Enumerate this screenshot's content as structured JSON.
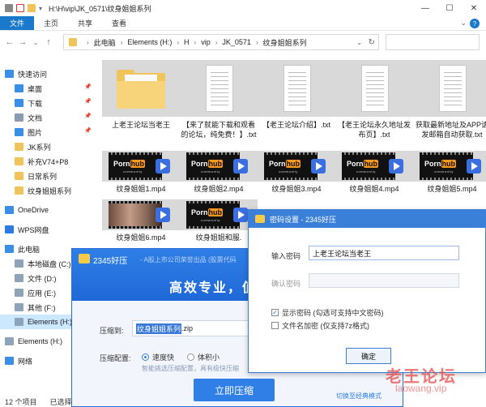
{
  "window": {
    "title": "H:\\H\\vip\\JK_0571\\纹身姐姐系列"
  },
  "ribbon": {
    "tabs": [
      "文件",
      "主页",
      "共享",
      "查看"
    ]
  },
  "address": {
    "crumbs": [
      "此电脑",
      "Elements (H:)",
      "H",
      "vip",
      "JK_0571",
      "纹身姐姐系列"
    ]
  },
  "sidebar": {
    "items": [
      {
        "label": "快速访问",
        "icon": "star-icon",
        "color": "#3a8ee6"
      },
      {
        "label": "桌面",
        "icon": "desktop-icon",
        "color": "#3a8ee6",
        "pinned": true
      },
      {
        "label": "下载",
        "icon": "download-icon",
        "color": "#3a8ee6",
        "pinned": true
      },
      {
        "label": "文档",
        "icon": "documents-icon",
        "color": "#8a9bb0",
        "pinned": true
      },
      {
        "label": "图片",
        "icon": "pictures-icon",
        "color": "#3a8ee6",
        "pinned": true
      },
      {
        "label": "JK系列",
        "icon": "folder-icon",
        "color": "#f0c45a"
      },
      {
        "label": "补充V74+P8",
        "icon": "folder-icon",
        "color": "#f0c45a"
      },
      {
        "label": "日常系列",
        "icon": "folder-icon",
        "color": "#f0c45a"
      },
      {
        "label": "纹身姐姐系列",
        "icon": "folder-icon",
        "color": "#f0c45a"
      },
      {
        "label": "OneDrive",
        "icon": "onedrive-icon",
        "color": "#3a8ee6"
      },
      {
        "label": "WPS网盘",
        "icon": "cloud-icon",
        "color": "#2c7be5"
      },
      {
        "label": "此电脑",
        "icon": "pc-icon",
        "color": "#3a8ee6"
      },
      {
        "label": "本地磁盘 (C:)",
        "icon": "drive-icon",
        "color": "#8fa3b8"
      },
      {
        "label": "文件 (D:)",
        "icon": "drive-icon",
        "color": "#8fa3b8"
      },
      {
        "label": "应用 (E:)",
        "icon": "drive-icon",
        "color": "#8fa3b8"
      },
      {
        "label": "其他 (F:)",
        "icon": "drive-icon",
        "color": "#8fa3b8"
      },
      {
        "label": "Elements (H:)",
        "icon": "drive-icon",
        "color": "#8fa3b8",
        "active": true
      },
      {
        "label": "Elements (H:)",
        "icon": "drive-icon",
        "color": "#8fa3b8"
      },
      {
        "label": "网络",
        "icon": "network-icon",
        "color": "#3a8ee6"
      }
    ]
  },
  "files": [
    {
      "name": "上老王论坛当老王",
      "kind": "folder"
    },
    {
      "name": "【来了就能下载和观看的论坛，纯免费！】.txt",
      "kind": "txt"
    },
    {
      "name": "【老王论坛介绍】.txt",
      "kind": "txt"
    },
    {
      "name": "【老王论坛永久地址发布页】.txt",
      "kind": "txt"
    },
    {
      "name": "获取最新地址及APP请发邮箱自动获取.txt",
      "kind": "txt"
    },
    {
      "name": "纹身姐姐1.mp4",
      "kind": "video"
    },
    {
      "name": "纹身姐姐2.mp4",
      "kind": "video"
    },
    {
      "name": "纹身姐姐3.mp4",
      "kind": "video"
    },
    {
      "name": "纹身姐姐4.mp4",
      "kind": "video"
    },
    {
      "name": "纹身姐姐5.mp4",
      "kind": "video"
    },
    {
      "name": "纹身姐姐6.mp4",
      "kind": "video-photo"
    },
    {
      "name": "纹身姐姐和服.",
      "kind": "video"
    }
  ],
  "video_logo": {
    "porn": "Porn",
    "hub": "hub",
    "sub": "community"
  },
  "status": {
    "count": "12 个项目",
    "selected": "已选择"
  },
  "zip": {
    "title": "2345好压",
    "subtitle": "- A股上市公司荣誉出品 (股票代码",
    "slogan": "高效专业，值",
    "path_label": "压缩到:",
    "path_selected": "纹身姐姐系列",
    "path_ext": ".zip",
    "config_label": "压缩配置:",
    "opt_fast": "速度快",
    "opt_small": "体积小",
    "hint": "智能挑选压缩配置，具有极快压缩",
    "start": "立即压缩",
    "classic": "切换至经典模式"
  },
  "password": {
    "title": "密码设置 - 2345好压",
    "label_pwd": "输入密码",
    "value_pwd": "上老王论坛当老王",
    "label_confirm": "确认密码",
    "show_pwd": "显示密码 (勾选可支持中文密码)",
    "encrypt_names": "文件名加密 (仅支持7z格式)",
    "ok": "确定"
  },
  "watermark": {
    "text": "老王论坛",
    "url": "laowang.vip"
  },
  "colors": {
    "accent": "#1979ca",
    "zip_blue": "#2f7fe6",
    "watermark": "#e64b4b"
  }
}
